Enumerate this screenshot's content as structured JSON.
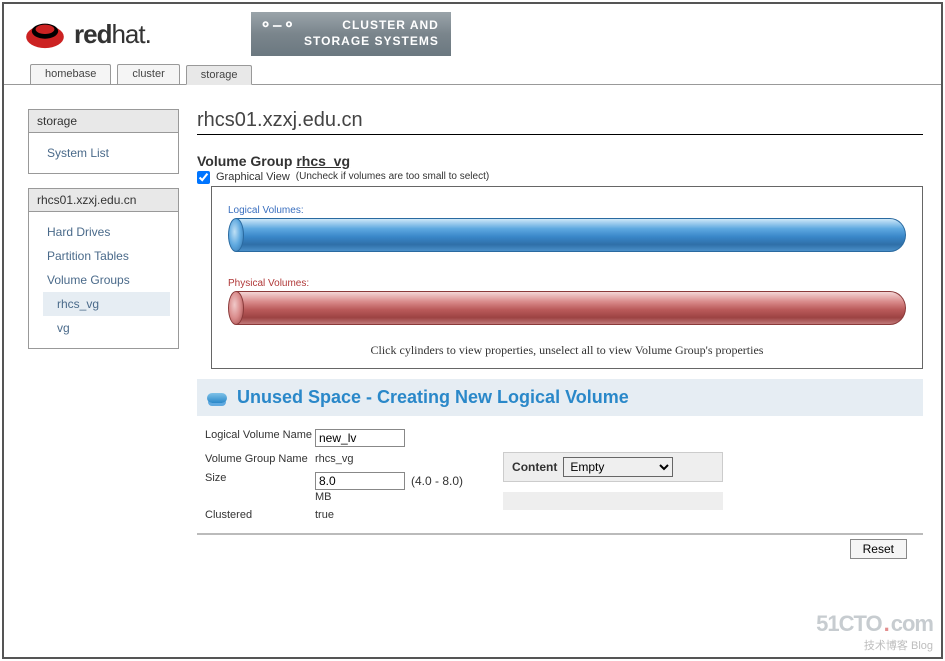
{
  "header": {
    "brand_red": "red",
    "brand_hat": "hat",
    "banner_line1": "CLUSTER AND",
    "banner_line2": "STORAGE SYSTEMS"
  },
  "tabs": {
    "homebase": "homebase",
    "cluster": "cluster",
    "storage": "storage",
    "active": "storage"
  },
  "sidebar": {
    "box1": {
      "title": "storage",
      "items": [
        "System List"
      ]
    },
    "box2": {
      "title": "rhcs01.xzxj.edu.cn",
      "items": [
        "Hard Drives",
        "Partition Tables",
        "Volume Groups",
        "rhcs_vg",
        "vg"
      ],
      "active_index": 3
    }
  },
  "content": {
    "host": "rhcs01.xzxj.edu.cn",
    "vg_label": "Volume Group",
    "vg_name": "rhcs_vg",
    "graphical_view_label": "Graphical View",
    "graphical_view_hint": "(Uncheck if volumes are too small to select)",
    "graphical_view_checked": true,
    "lv_label": "Logical Volumes:",
    "pv_label": "Physical Volumes:",
    "graph_hint": "Click cylinders to view properties, unselect all to view Volume Group's properties",
    "section_title": "Unused Space - Creating New Logical Volume"
  },
  "form": {
    "lv_name_label": "Logical Volume Name",
    "lv_name_value": "new_lv",
    "vg_name_label": "Volume Group Name",
    "vg_name_value": "rhcs_vg",
    "size_label": "Size",
    "size_value": "8.0",
    "size_range": "(4.0 - 8.0)",
    "size_unit": "MB",
    "clustered_label": "Clustered",
    "clustered_value": "true",
    "content_label": "Content",
    "content_selected": "Empty",
    "reset_button": "Reset"
  },
  "watermark": {
    "main1": "51CTO",
    "main2": "com",
    "sub": "技术博客   Blog"
  }
}
